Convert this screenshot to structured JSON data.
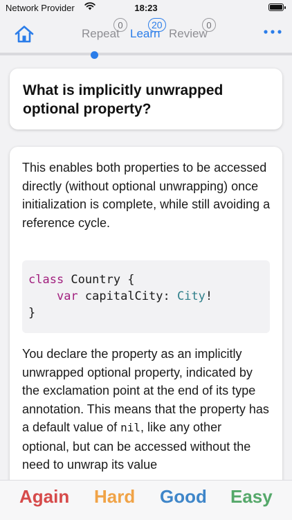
{
  "status_bar": {
    "carrier": "Network Provider",
    "time": "18:23"
  },
  "nav": {
    "tabs": [
      {
        "label": "Repeat",
        "count": "0"
      },
      {
        "label": "Learn",
        "count": "20"
      },
      {
        "label": "Review",
        "count": "0"
      }
    ],
    "active_tab": "Learn",
    "icons": {
      "home": "house-icon",
      "menu": "ellipsis-icon"
    }
  },
  "card": {
    "question": "What is implicitly unwrapped optional property?",
    "answer_intro": "This enables both properties to be accessed directly (without optional unwrapping) once initialization is complete, while still avoiding a reference cycle.",
    "code": {
      "line1_kw": "class",
      "line1_rest": " Country {",
      "line2_indent": "    ",
      "line2_kw": "var",
      "line2_mid": " capitalCity: ",
      "line2_type": "City",
      "line2_end": "!",
      "line3": "}"
    },
    "answer_body_before": "You declare the property as an implicitly unwrapped optional property, indicated by the exclamation point at the end of its type annotation. This means that the property has a default value of ",
    "answer_body_code": "nil",
    "answer_body_after": ", like any other optional, but can be accessed without the need to unwrap its value"
  },
  "answers": {
    "again": "Again",
    "hard": "Hard",
    "good": "Good",
    "easy": "Easy"
  },
  "colors": {
    "accent": "#2b7de9",
    "again": "#d64a4a",
    "hard": "#f0a347",
    "good": "#3f86c9",
    "easy": "#55a86a"
  }
}
